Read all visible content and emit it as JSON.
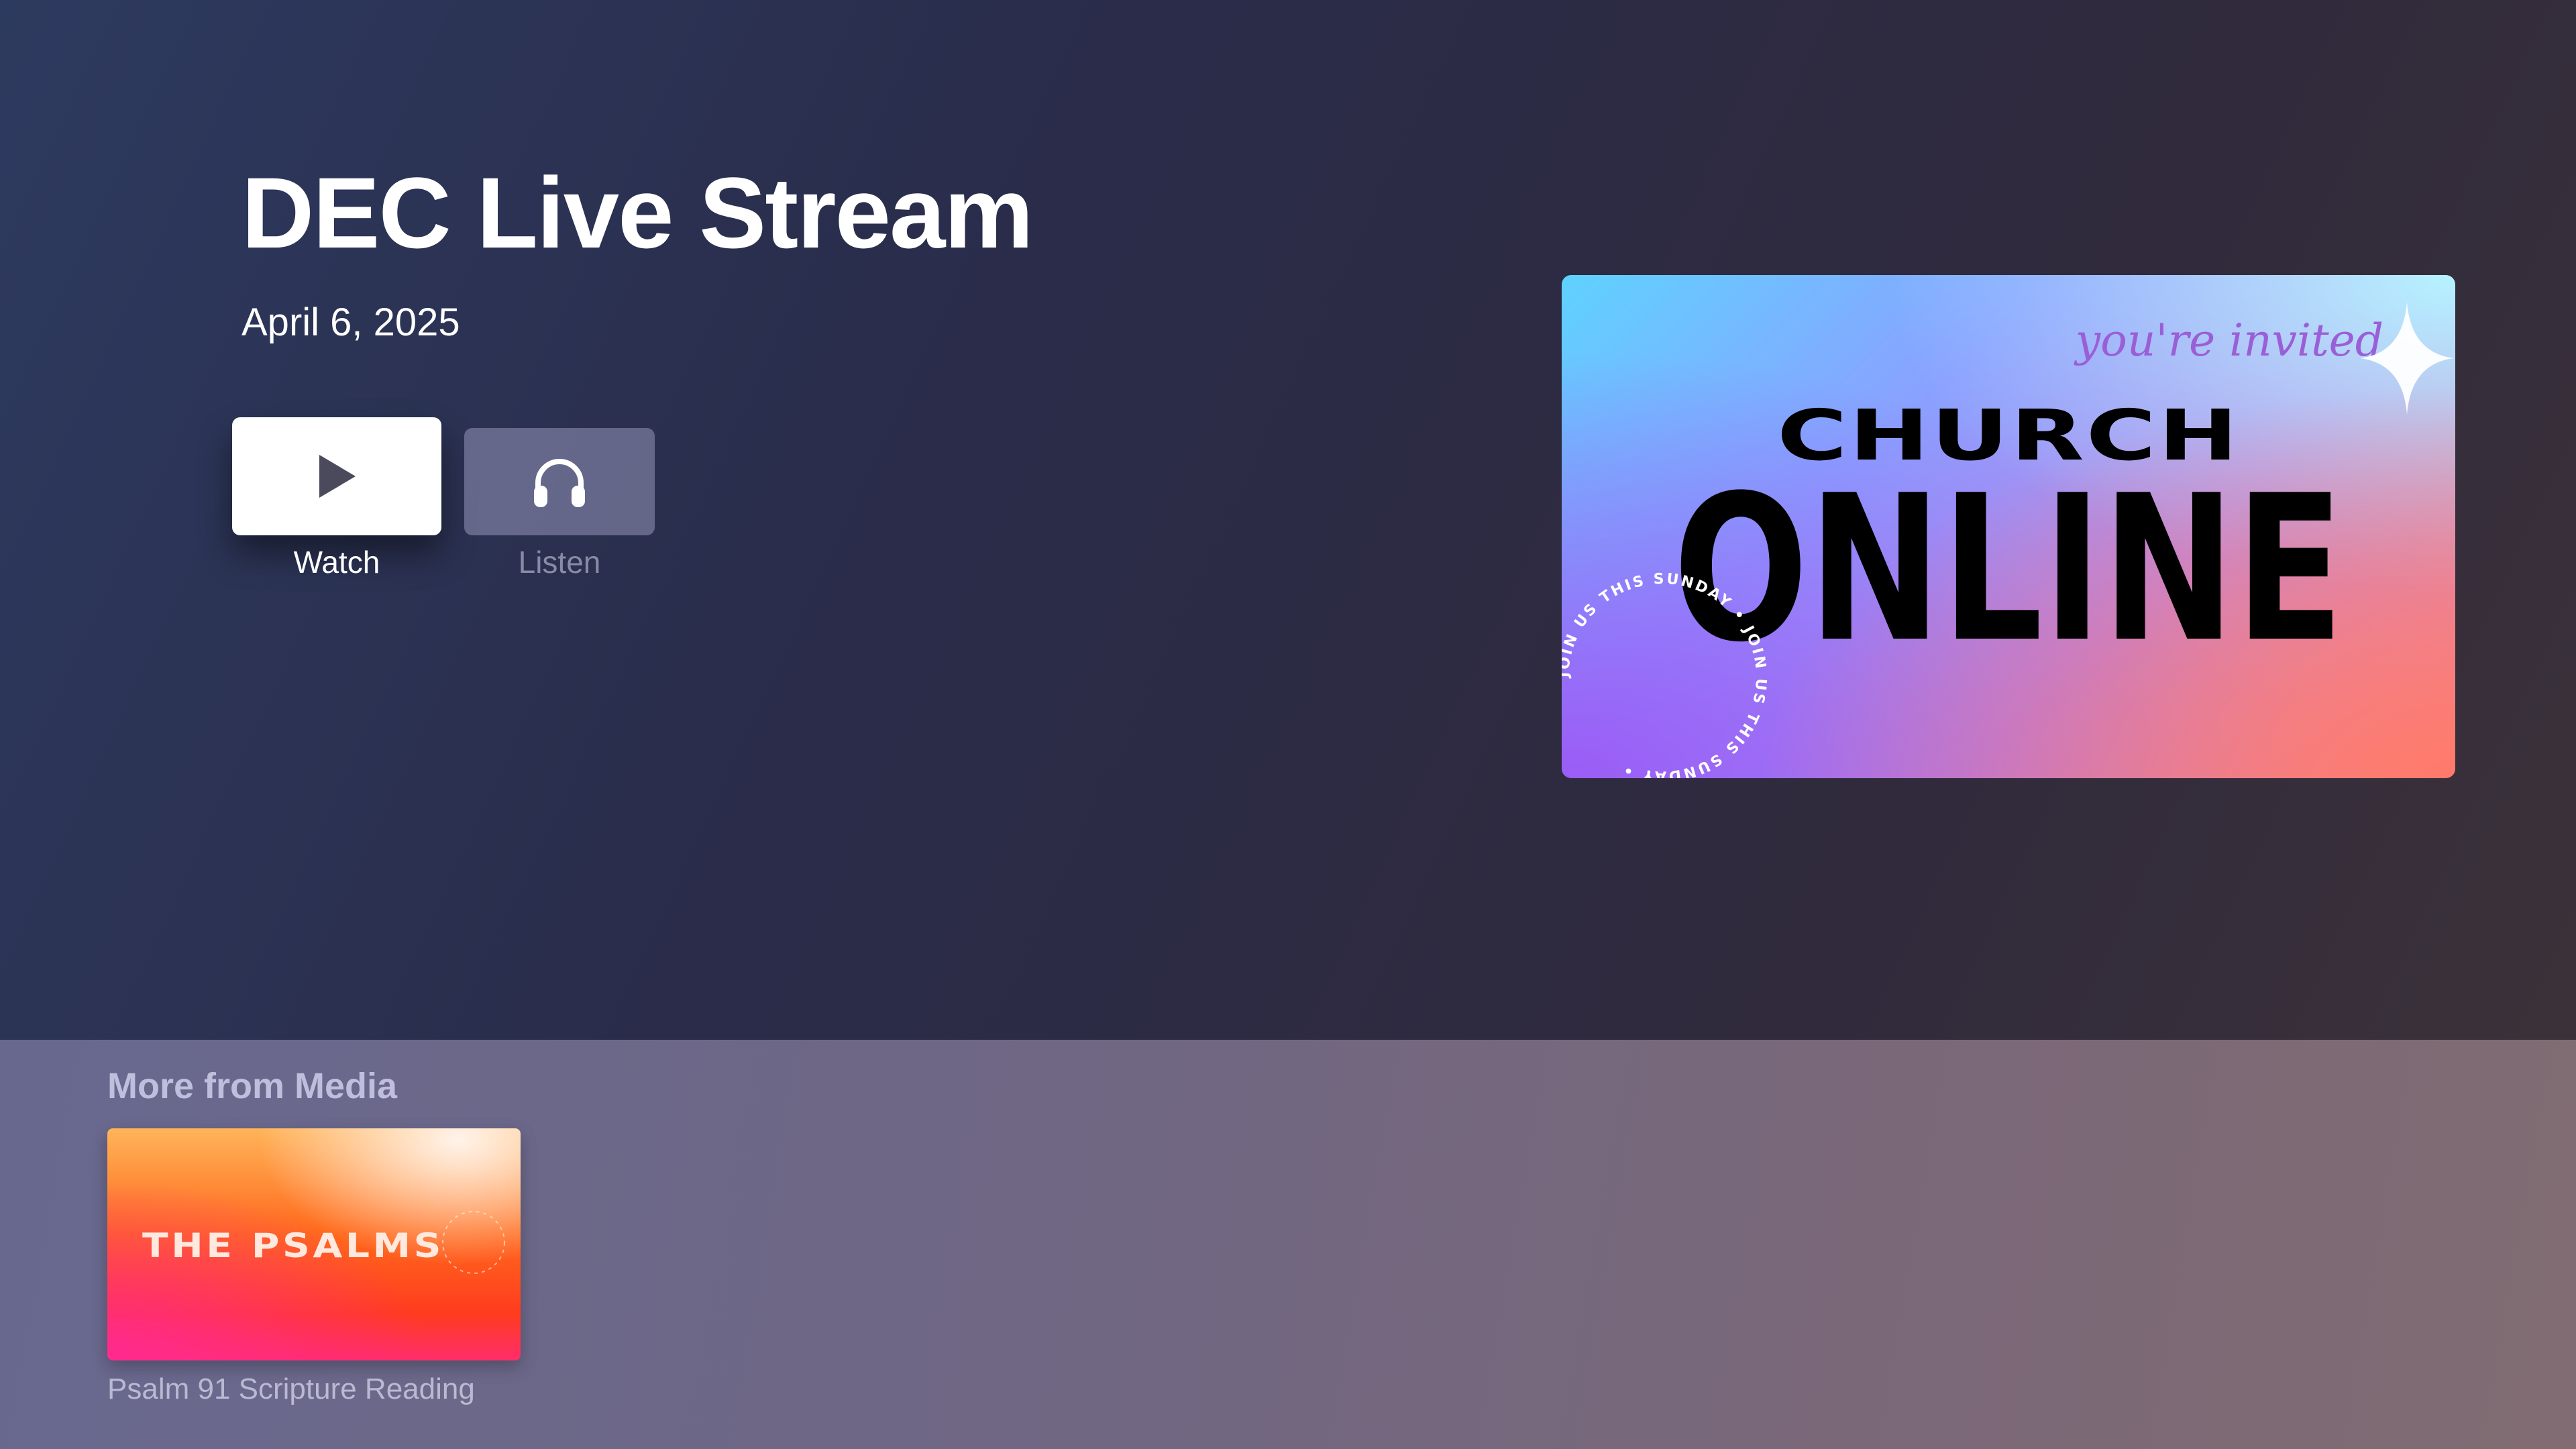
{
  "detail": {
    "title": "DEC Live Stream",
    "date": "April 6, 2025",
    "actions": [
      {
        "label": "Watch",
        "icon": "play-icon",
        "focused": true
      },
      {
        "label": "Listen",
        "icon": "headphones-icon",
        "focused": false
      }
    ],
    "artwork": {
      "script_text": "you're invited",
      "headline_top": "CHURCH",
      "headline_main": "ONLINE",
      "circular_text": "JOIN US THIS SUNDAY • JOIN US THIS SUNDAY •"
    }
  },
  "shelf": {
    "title": "More from Media",
    "items": [
      {
        "title": "Psalm 91 Scripture Reading",
        "art_text": "THE PSALMS"
      }
    ]
  },
  "colors": {
    "focused_button": "#ffffff",
    "unfocused_button": "#8787a8",
    "shelf_background": "#6f6784",
    "art_orange": "#ff6a1c",
    "art_pink": "#ff2d6a"
  }
}
